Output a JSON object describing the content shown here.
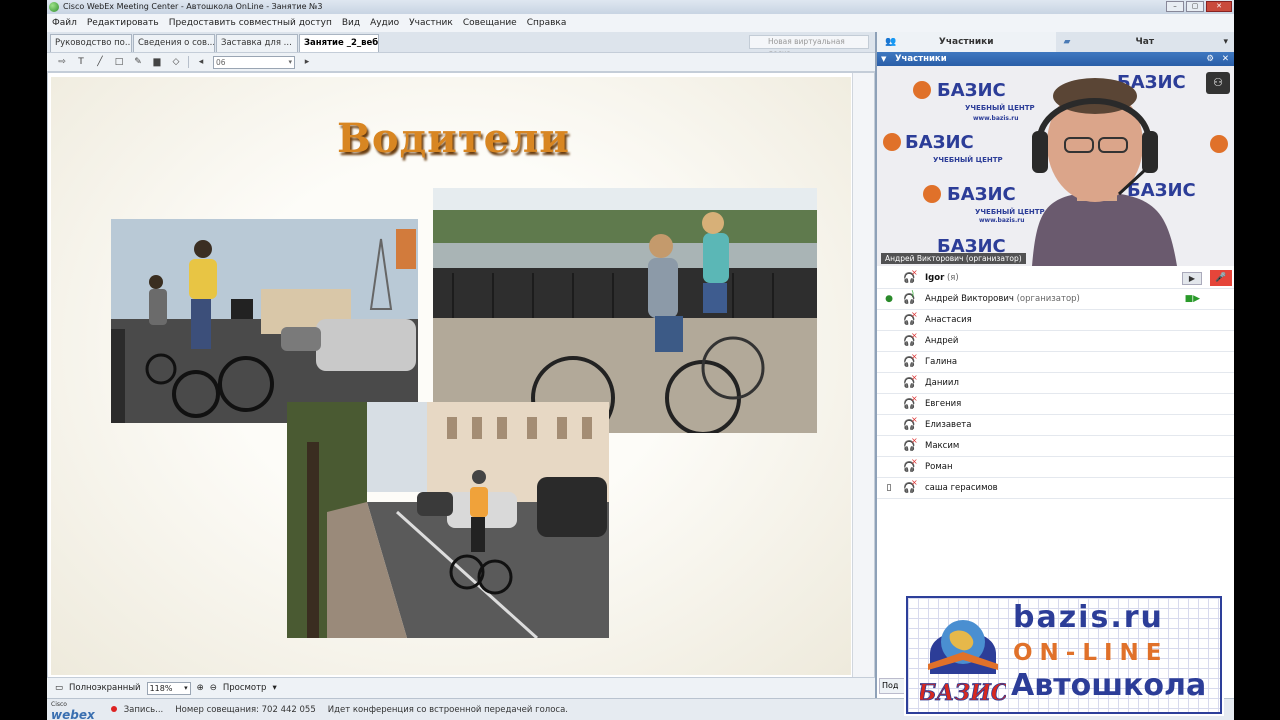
{
  "window": {
    "title": "Cisco WebEx Meeting Center - Автошкола OnLine  - Занятие №3",
    "controls": [
      "–",
      "▢",
      "✕"
    ]
  },
  "menu": [
    "Файл",
    "Редактировать",
    "Предоставить совместный доступ",
    "Вид",
    "Аудио",
    "Участник",
    "Совещание",
    "Справка"
  ],
  "doc_tabs": [
    "Руководство по...",
    "Сведения о сов...",
    "Заставка для ...",
    "Занятие _2_веб"
  ],
  "new_whiteboard": "Новая виртуальная доска",
  "toolbar": {
    "page_value": "06",
    "prev": "◂",
    "next": "▸"
  },
  "slide": {
    "title": "Водители"
  },
  "bottombar": {
    "fullscreen": "Полноэкранный",
    "zoom": "118%",
    "view": "Просмотр"
  },
  "status": {
    "brand_top": "Cisco",
    "brand": "webex",
    "recording": "Запись...",
    "meeting_number": "Номер совещания: 702 442 055",
    "audio_note": "Идет конференция со встроенной передачей голоса."
  },
  "panel": {
    "tab_participants": "Участники",
    "tab_chat": "Чат",
    "section_title": "Участники",
    "video_label": "Андрей Викторович (организатор)",
    "video_bg_text": [
      "БАЗИС",
      "УЧЕБНЫЙ ЦЕНТР",
      "www.bazis.ru"
    ],
    "participants": [
      {
        "name": "Igor",
        "note": "(я)",
        "bold": true
      },
      {
        "name": "Андрей Викторович",
        "note": "(организатор)"
      },
      {
        "name": "Анастасия",
        "note": ""
      },
      {
        "name": "Андрей",
        "note": ""
      },
      {
        "name": "Галина",
        "note": ""
      },
      {
        "name": "Даниил",
        "note": ""
      },
      {
        "name": "Евгения",
        "note": ""
      },
      {
        "name": "Елизавета",
        "note": ""
      },
      {
        "name": "Максим",
        "note": ""
      },
      {
        "name": "Роман",
        "note": ""
      },
      {
        "name": "саша герасимов",
        "note": ""
      }
    ],
    "bottom_cut": "Под"
  },
  "banner": {
    "line1": "bazis.ru",
    "line2": "ON-LINE",
    "line3": "Автошкола",
    "emblem_text": "БАЗИС"
  }
}
